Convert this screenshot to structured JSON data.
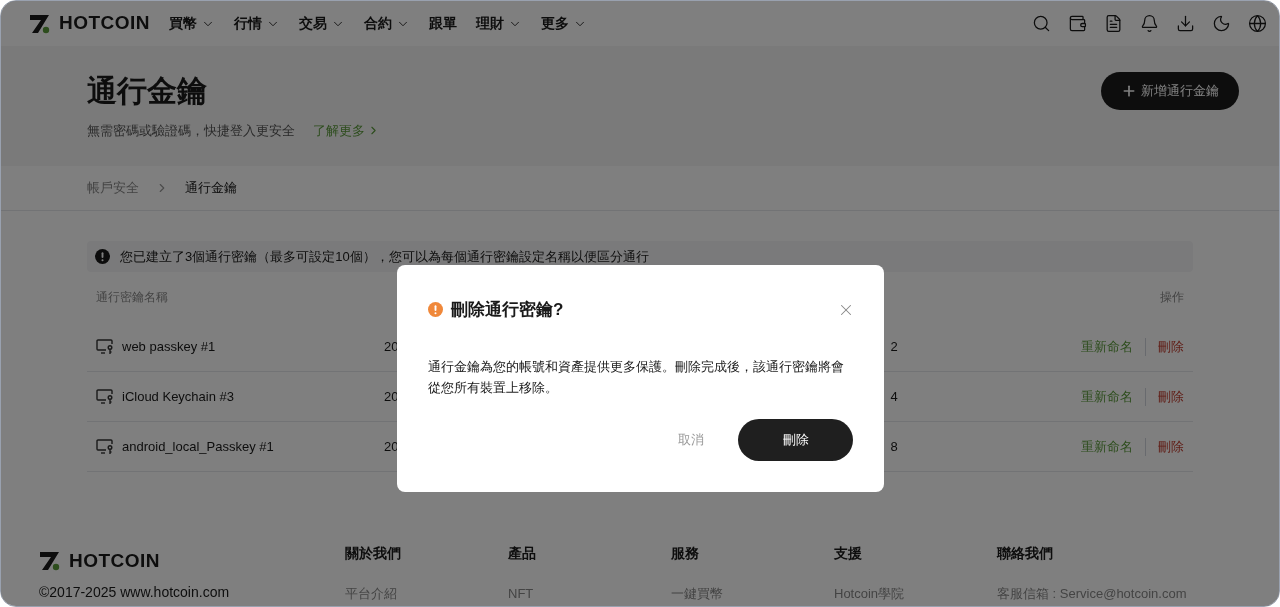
{
  "header": {
    "brand": "HOTCOIN",
    "nav": [
      {
        "label": "買幣",
        "dropdown": true
      },
      {
        "label": "行情",
        "dropdown": true
      },
      {
        "label": "交易",
        "dropdown": true
      },
      {
        "label": "合約",
        "dropdown": true
      },
      {
        "label": "跟單",
        "dropdown": false
      },
      {
        "label": "理財",
        "dropdown": true
      },
      {
        "label": "更多",
        "dropdown": true
      }
    ]
  },
  "hero": {
    "title": "通行金鑰",
    "subtitle": "無需密碼或驗證碼，快捷登入更安全",
    "learn_more": "了解更多",
    "add_button": "新增通行金鑰"
  },
  "breadcrumb": [
    {
      "label": "帳戶安全",
      "selected": false
    },
    {
      "label": "通行金鑰",
      "selected": true
    }
  ],
  "notice": "您已建立了3個通行密鑰（最多可設定10個），您可以為每個通行密鑰設定名稱以便區分通行",
  "table": {
    "columns": [
      {
        "label": "通行密鑰名稱"
      },
      {
        "label": "操作"
      }
    ],
    "rows": [
      {
        "name": "web passkey #1",
        "column_2": "20",
        "column_3": "2",
        "rename": "重新命名",
        "delete": "刪除"
      },
      {
        "name": "iCloud Keychain #3",
        "column_2": "20",
        "column_3": "4",
        "rename": "重新命名",
        "delete": "刪除"
      },
      {
        "name": "android_local_Passkey #1",
        "column_2": "20",
        "column_3": "8",
        "rename": "重新命名",
        "delete": "刪除"
      }
    ]
  },
  "dialog": {
    "title": "刪除通行密鑰?",
    "body": "通行金鑰為您的帳號和資產提供更多保護。刪除完成後，該通行密鑰將會從您所有裝置上移除。",
    "cancel": "取消",
    "confirm": "刪除"
  },
  "footer": {
    "brand": "HOTCOIN",
    "copyright": "©2017-2025 www.hotcoin.com",
    "columns": [
      {
        "heading": "關於我們",
        "link": "平台介紹"
      },
      {
        "heading": "產品",
        "link": "NFT"
      },
      {
        "heading": "服務",
        "link": "一鍵買幣"
      },
      {
        "heading": "支援",
        "link": "Hotcoin學院"
      },
      {
        "heading": "聯絡我們",
        "link": "客服信箱 : Service@hotcoin.com"
      }
    ]
  }
}
